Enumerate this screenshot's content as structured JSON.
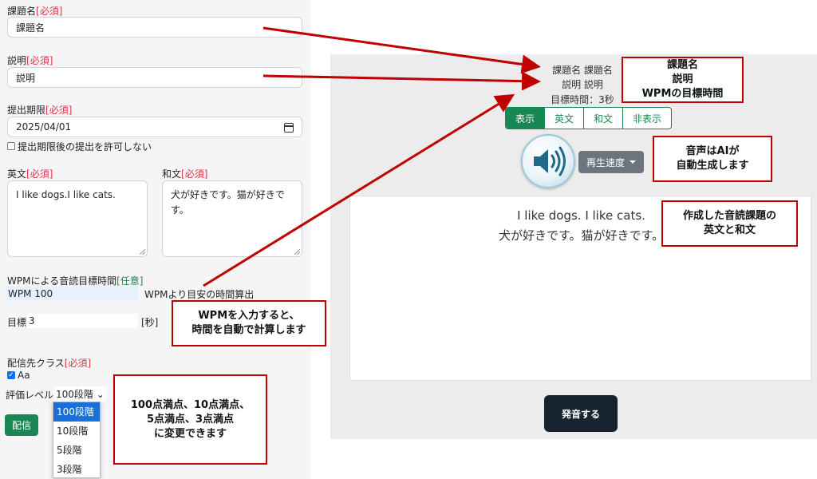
{
  "form": {
    "title_label": "課題名",
    "desc_label": "説明",
    "deadline_label": "提出期限",
    "required_tag": "[必須]",
    "optional_tag": "[任意]",
    "title_value": "課題名",
    "desc_value": "説明",
    "deadline_value": "2025/04/01",
    "late_label": "提出期限後の提出を許可しない",
    "english_label": "英文",
    "japanese_label": "和文",
    "english_value": "I like dogs.I like cats.",
    "japanese_value_1": "犬が好きです。猫が好きで",
    "japanese_value_2": "す。",
    "wpm_section_label": "WPMによる音読目標時間",
    "wpm_input_value": "WPM 100",
    "wpm_hint": "WPMより目安の時間算出",
    "target_label": "目標",
    "target_value": "3",
    "target_unit": "[秒]",
    "class_label": "配信先クラス",
    "class_option": "Aa",
    "eval_label": "評価レベル",
    "eval_selected": "100段階",
    "eval_options": [
      "100段階",
      "10段階",
      "5段階",
      "3段階"
    ],
    "submit_label": "配信"
  },
  "preview": {
    "title_line": "課題名 課題名",
    "desc_line": "説明 説明",
    "time_line": "目標時間：3秒",
    "tabs": [
      "表示",
      "英文",
      "和文",
      "非表示"
    ],
    "speed_label": "再生速度",
    "english_text": "I like dogs. I like cats.",
    "japanese_text": "犬が好きです。猫が好きです。",
    "speak_label": "発音する"
  },
  "callouts": {
    "c1_line1": "課題名",
    "c1_line2": "説明",
    "c1_line3": "WPMの目標時間",
    "c2_line1": "音声はAIが",
    "c2_line2": "自動生成します",
    "c3_line1": "作成した音読課題の",
    "c3_line2": "英文と和文",
    "c4_line1": "WPMを入力すると、",
    "c4_line2": "時間を自動で計算します",
    "c5_line1": "100点満点、10点満点、",
    "c5_line2": "5点満点、3点満点",
    "c5_line3": "に変更できます"
  },
  "colors": {
    "required": "#dc3545",
    "accent_green": "#198754",
    "annotation_red": "#c00000"
  }
}
